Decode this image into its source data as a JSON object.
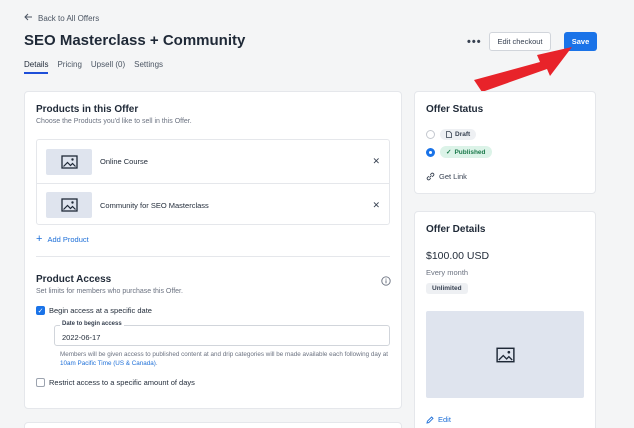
{
  "header": {
    "back_label": "Back to All Offers",
    "title": "SEO Masterclass + Community",
    "more_label": "•••",
    "edit_checkout_label": "Edit checkout",
    "save_label": "Save",
    "tabs": [
      {
        "label": "Details",
        "active": true
      },
      {
        "label": "Pricing",
        "active": false
      },
      {
        "label": "Upsell (0)",
        "active": false
      },
      {
        "label": "Settings",
        "active": false
      }
    ]
  },
  "products": {
    "title": "Products in this Offer",
    "subtitle": "Choose the Products you'd like to sell in this Offer.",
    "items": [
      {
        "name": "Online Course"
      },
      {
        "name": "Community for SEO Masterclass"
      }
    ],
    "add_label": "Add Product"
  },
  "access": {
    "title": "Product Access",
    "subtitle": "Set limits for members who purchase this Offer.",
    "begin_label": "Begin access at a specific date",
    "begin_checked": true,
    "date_label": "Date to begin access",
    "date_value": "2022-06-17",
    "note_prefix": "Members will be given access to published content at and drip categories will be made available each following day at",
    "note_link": "10am Pacific Time (US & Canada)",
    "note_suffix": ".",
    "restrict_label": "Restrict access to a specific amount of days",
    "restrict_checked": false
  },
  "status": {
    "title": "Offer Status",
    "options": [
      {
        "label": "Draft",
        "selected": false
      },
      {
        "label": "Published",
        "selected": true
      }
    ],
    "get_link_label": "Get Link"
  },
  "details": {
    "title": "Offer Details",
    "price": "$100.00 USD",
    "period": "Every month",
    "badge": "Unlimited",
    "edit_label": "Edit"
  },
  "colors": {
    "accent": "#1a73e8",
    "arrow": "#e8232a",
    "published_bg": "#dcf3e8",
    "published_text": "#1b7a4b"
  }
}
